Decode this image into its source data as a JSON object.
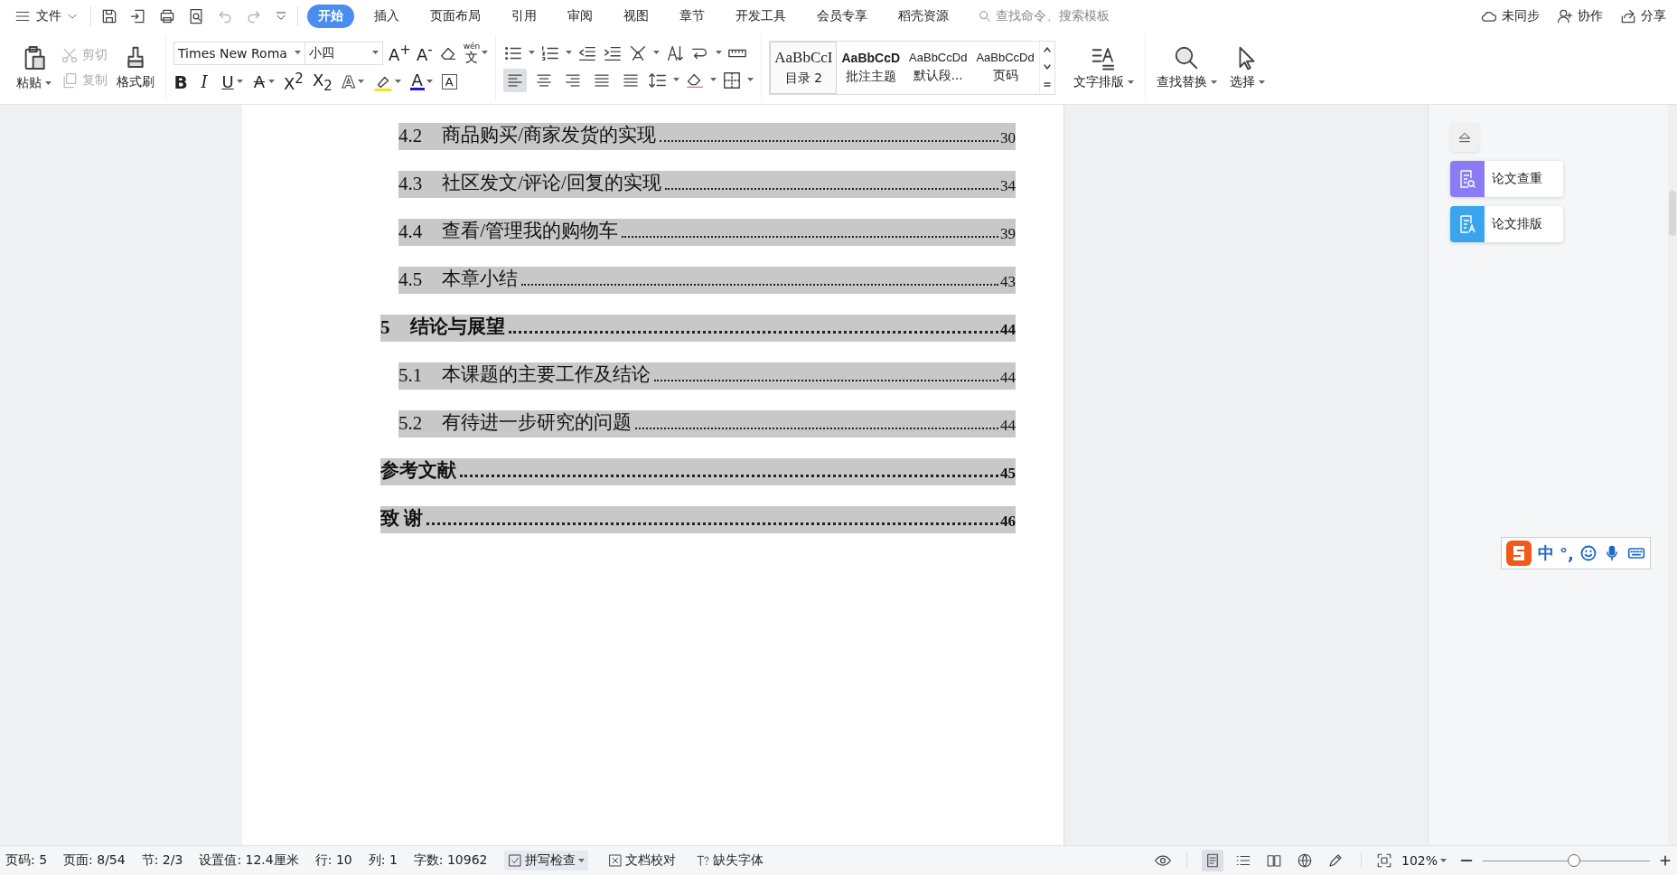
{
  "menubar": {
    "file_menu": "文件",
    "tabs": [
      {
        "label": "开始",
        "selected": true
      },
      {
        "label": "插入",
        "selected": false
      },
      {
        "label": "页面布局",
        "selected": false
      },
      {
        "label": "引用",
        "selected": false
      },
      {
        "label": "审阅",
        "selected": false
      },
      {
        "label": "视图",
        "selected": false
      },
      {
        "label": "章节",
        "selected": false
      },
      {
        "label": "开发工具",
        "selected": false
      },
      {
        "label": "会员专享",
        "selected": false
      },
      {
        "label": "稻壳资源",
        "selected": false
      }
    ],
    "search": {
      "placeholder": "查找命令、搜索模板"
    },
    "actions": [
      "未同步",
      "协作",
      "分享"
    ]
  },
  "ribbon": {
    "clipboard": {
      "paste": "粘贴",
      "cut": {
        "label": "剪切",
        "disabled": true
      },
      "copy": {
        "label": "复制",
        "disabled": true
      },
      "format_painter": "格式刷"
    },
    "font": {
      "name": "Times New Roma",
      "size": "小四",
      "grow": "A$^{+}$",
      "shrink": "A$^{-}$",
      "pinyin": {
        "reading": "wén",
        "char": "文"
      },
      "buttons": [
        {
          "kind": "bold",
          "label": "B"
        },
        {
          "kind": "italic",
          "label": "I"
        },
        {
          "kind": "underline",
          "label": "U"
        },
        {
          "kind": "strike",
          "label": "A"
        },
        {
          "kind": "plain",
          "label": "X$^{2}$"
        },
        {
          "kind": "plain",
          "label": "X$_{2}$"
        },
        {
          "kind": "outline",
          "label": "A"
        },
        {
          "kind": "highlight"
        },
        {
          "kind": "color",
          "label": "A"
        },
        {
          "kind": "boxed",
          "label": "A"
        }
      ]
    },
    "alignments": [
      {
        "kind": "left",
        "selected": true
      },
      {
        "kind": "center",
        "selected": false
      },
      {
        "kind": "right",
        "selected": false
      },
      {
        "kind": "justify",
        "selected": false
      },
      {
        "kind": "distributed",
        "selected": false
      }
    ],
    "styles": [
      {
        "kind": "serif",
        "preview": "AaBbCcI",
        "label": "目录 2",
        "selected": true
      },
      {
        "kind": "bold",
        "preview": "AaBbCcD",
        "label": "批注主题",
        "selected": false
      },
      {
        "kind": "sans",
        "preview": "AaBbCcDd",
        "label": "默认段...",
        "selected": false
      },
      {
        "kind": "sans",
        "preview": "AaBbCcDd",
        "label": "页码",
        "selected": false
      }
    ],
    "tools": [
      "文字排版",
      "查找替换",
      "选择"
    ]
  },
  "toc": [
    {
      "kind": "section",
      "number": "4.2",
      "title": "商品购买/商家发货的实现",
      "page": "30"
    },
    {
      "kind": "section",
      "number": "4.3",
      "title": "社区发文/评论/回复的实现",
      "page": "34"
    },
    {
      "kind": "section",
      "number": "4.4",
      "title": "查看/管理我的购物车",
      "page": "39"
    },
    {
      "kind": "section",
      "number": "4.5",
      "title": "本章小结",
      "page": "43"
    },
    {
      "kind": "chapter",
      "number": "5",
      "title": "结论与展望",
      "page": "44"
    },
    {
      "kind": "section",
      "number": "5.1",
      "title": "本课题的主要工作及结论",
      "page": "44"
    },
    {
      "kind": "section",
      "number": "5.2",
      "title": "有待进一步研究的问题",
      "page": "44"
    },
    {
      "kind": "chapter",
      "title": "参考文献",
      "page": "45"
    },
    {
      "kind": "chapter",
      "title": "致  谢",
      "page": "46"
    }
  ],
  "side_panel": {
    "buttons": [
      {
        "label": "论文查重",
        "color": "#8b7cf6"
      },
      {
        "label": "论文排版",
        "color": "#3aa5ee"
      }
    ]
  },
  "ime": {
    "mode": "中",
    "punctuation": "°,"
  },
  "status_bar": {
    "fields": [
      "页码: 5",
      "页面: 8/54",
      "节: 2/3",
      "设置值: 12.4厘米",
      "行: 10",
      "列: 1",
      "字数: 10962"
    ],
    "tools": [
      "拼写检查",
      "文档校对",
      "缺失字体"
    ],
    "views": [
      {
        "selected": true
      },
      {
        "selected": false
      },
      {
        "selected": false
      },
      {
        "selected": false
      },
      {
        "selected": false
      }
    ],
    "zoom": "102%",
    "zoom_slider": {
      "level": 0.55
    }
  }
}
